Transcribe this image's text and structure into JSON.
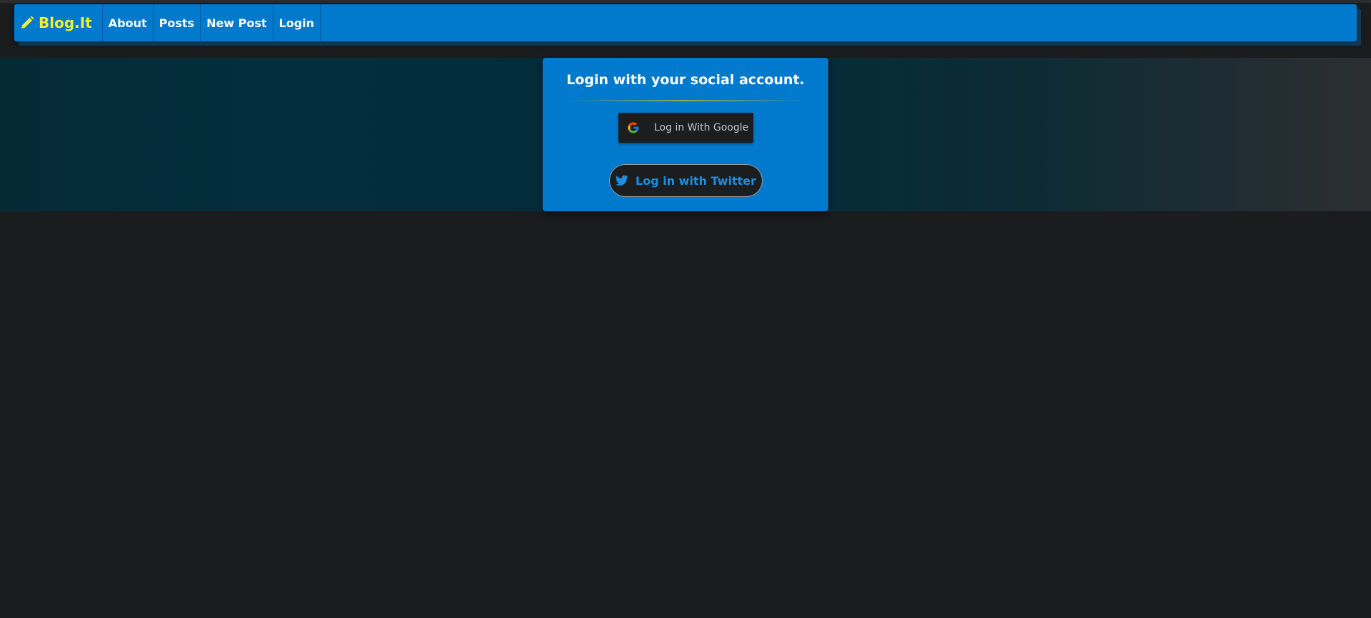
{
  "navbar": {
    "brand": "Blog.It",
    "brand_icon": "pencil-icon",
    "items": [
      {
        "label": "About"
      },
      {
        "label": "Posts"
      },
      {
        "label": "New Post"
      },
      {
        "label": "Login"
      }
    ]
  },
  "login_card": {
    "title": "Login with your social account.",
    "google_button": {
      "label": "Log in With Google",
      "icon": "google-icon"
    },
    "twitter_button": {
      "label": "Log in with Twitter",
      "icon": "twitter-icon"
    }
  },
  "colors": {
    "navbar_bg": "#0179cc",
    "brand": "#f4ef2c",
    "page_bg": "#1b1c1e",
    "hero_bg": "#042e3c",
    "twitter_text": "#1d8fe0"
  }
}
